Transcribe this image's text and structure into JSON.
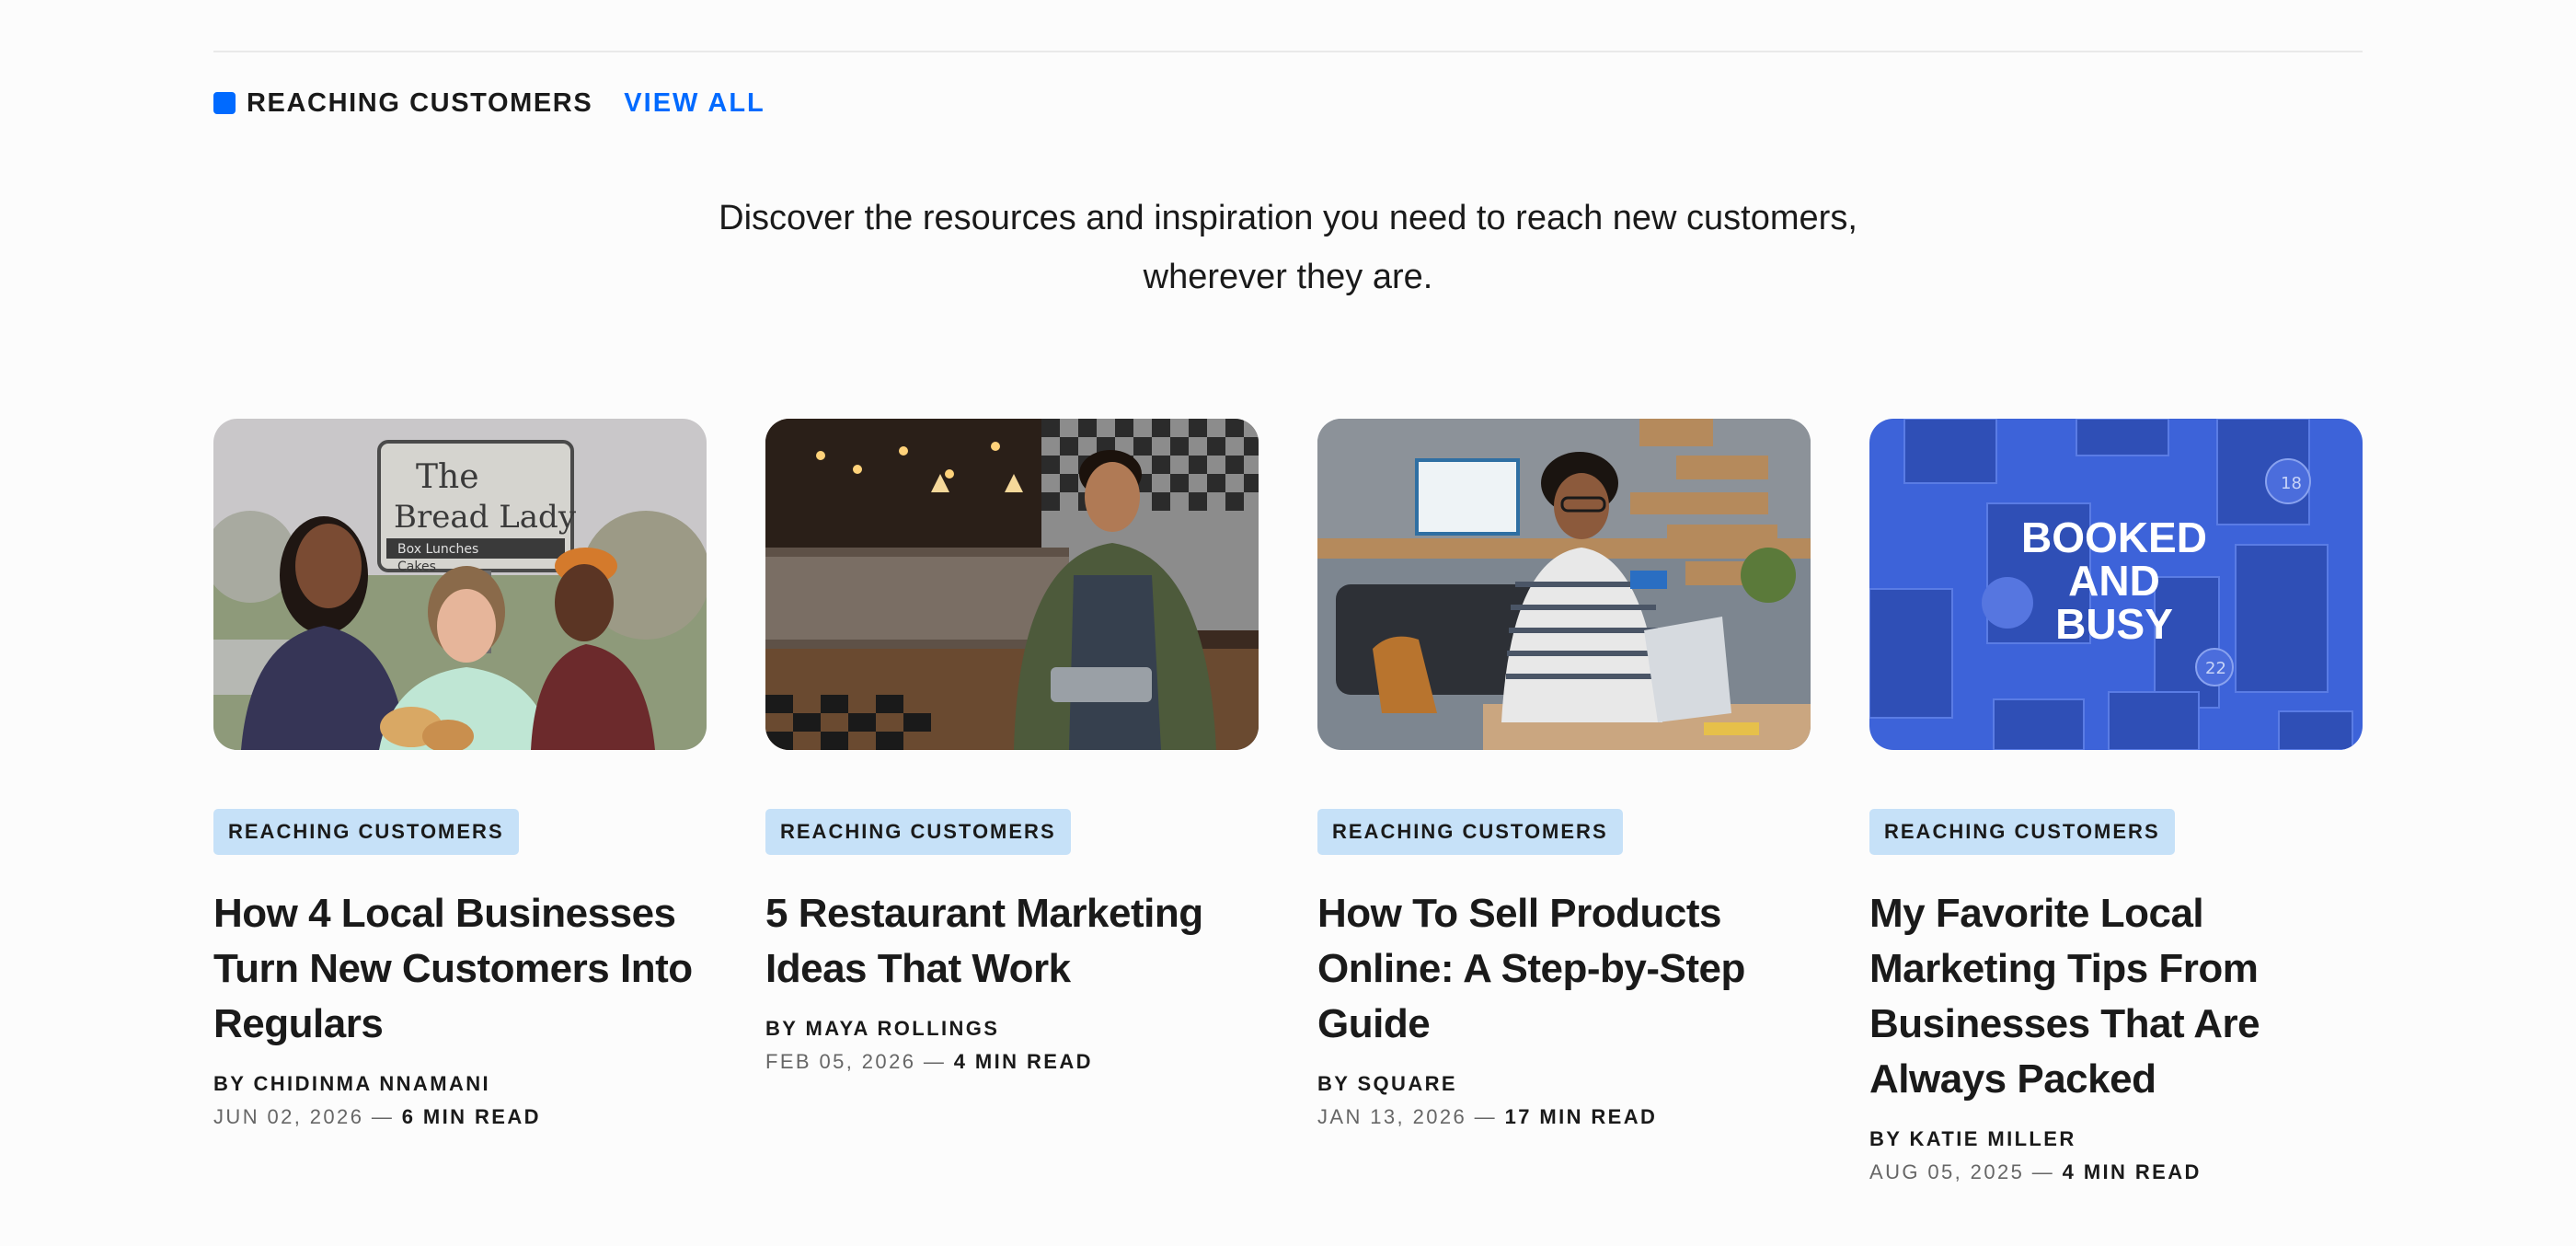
{
  "section": {
    "title": "REACHING CUSTOMERS",
    "view_all": "VIEW ALL",
    "intro": "Discover the resources and inspiration you need to reach new customers, wherever they are."
  },
  "colors": {
    "accent": "#006aff",
    "tag_bg": "#c6e1f8",
    "booked_bg": "#3d63d9"
  },
  "cards": [
    {
      "tag": "REACHING CUSTOMERS",
      "title": "How 4 Local Businesses Turn New Customers Into Regulars",
      "author": "BY CHIDINMA NNAMANI",
      "date": "JUN 02, 2026",
      "sep": " — ",
      "read": "6 MIN READ",
      "image": {
        "sign_line1": "The",
        "sign_line2": "Bread Lady",
        "sign_line3": "Box Lunches",
        "sign_line4": "Cakes"
      }
    },
    {
      "tag": "REACHING CUSTOMERS",
      "title": "5 Restaurant Marketing Ideas That Work",
      "author": "BY MAYA ROLLINGS",
      "date": "FEB 05, 2026",
      "sep": " — ",
      "read": "4 MIN READ"
    },
    {
      "tag": "REACHING CUSTOMERS",
      "title": "How To Sell Products Online: A Step-by-Step Guide",
      "author": "BY SQUARE",
      "date": "JAN 13, 2026",
      "sep": " — ",
      "read": "17 MIN READ"
    },
    {
      "tag": "REACHING CUSTOMERS",
      "title": "My Favorite Local Marketing Tips From Businesses That Are Always Packed",
      "author": "BY KATIE MILLER",
      "date": "AUG 05, 2025",
      "sep": " — ",
      "read": "4 MIN READ",
      "image": {
        "line1": "BOOKED",
        "line2": "AND",
        "line3": "BUSY",
        "badge1": "18",
        "badge2": "22"
      }
    }
  ]
}
